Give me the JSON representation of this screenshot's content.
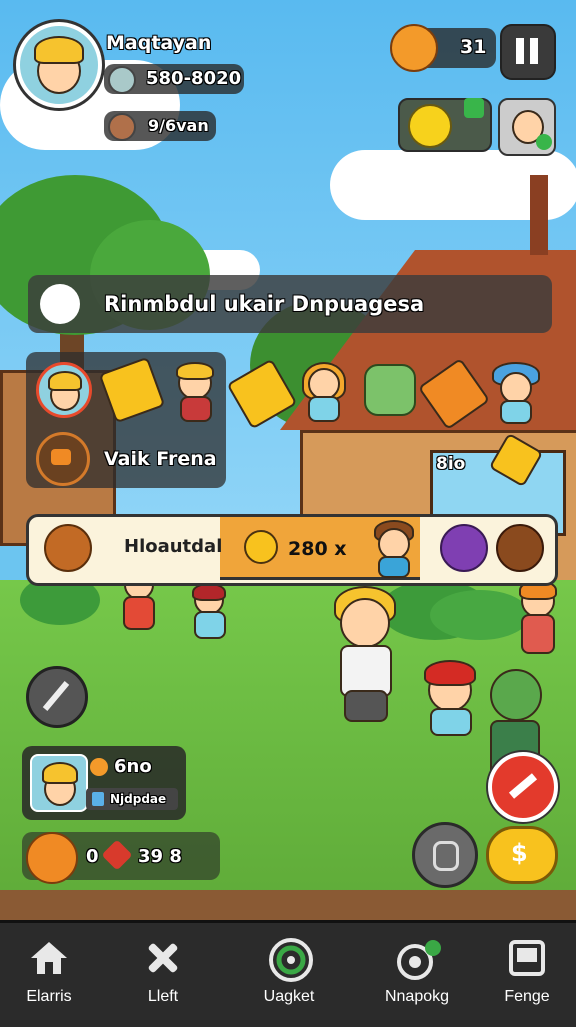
{
  "player": {
    "name": "Maqtayan",
    "coins": "580-8020",
    "gems": "9/6van"
  },
  "top_right": {
    "energy_count": "31",
    "pause_icon": "pause-icon"
  },
  "quest_banner": {
    "title": "Rinmbdul ukair Dnpuagesa"
  },
  "characters_panel": {
    "label": "Vaik Frena",
    "count": "8io"
  },
  "reward_bar": {
    "label": "Hloautdal",
    "amount": "280 x"
  },
  "player_card": {
    "value": "6no",
    "sub": "Njdpdae"
  },
  "resources": {
    "a": "0",
    "b": "39 8"
  },
  "bottom_nav": [
    {
      "label": "Elarris",
      "icon": "home-icon"
    },
    {
      "label": "Lleft",
      "icon": "tools-icon"
    },
    {
      "label": "Uagket",
      "icon": "target-icon"
    },
    {
      "label": "Nnapokg",
      "icon": "social-icon"
    },
    {
      "label": "Fenge",
      "icon": "shop-icon"
    }
  ],
  "colors": {
    "nav_bg": "#2b2b2b",
    "accent_orange": "#f0a53a",
    "accent_red": "#e33a2c",
    "accent_yellow": "#f8c21e"
  }
}
